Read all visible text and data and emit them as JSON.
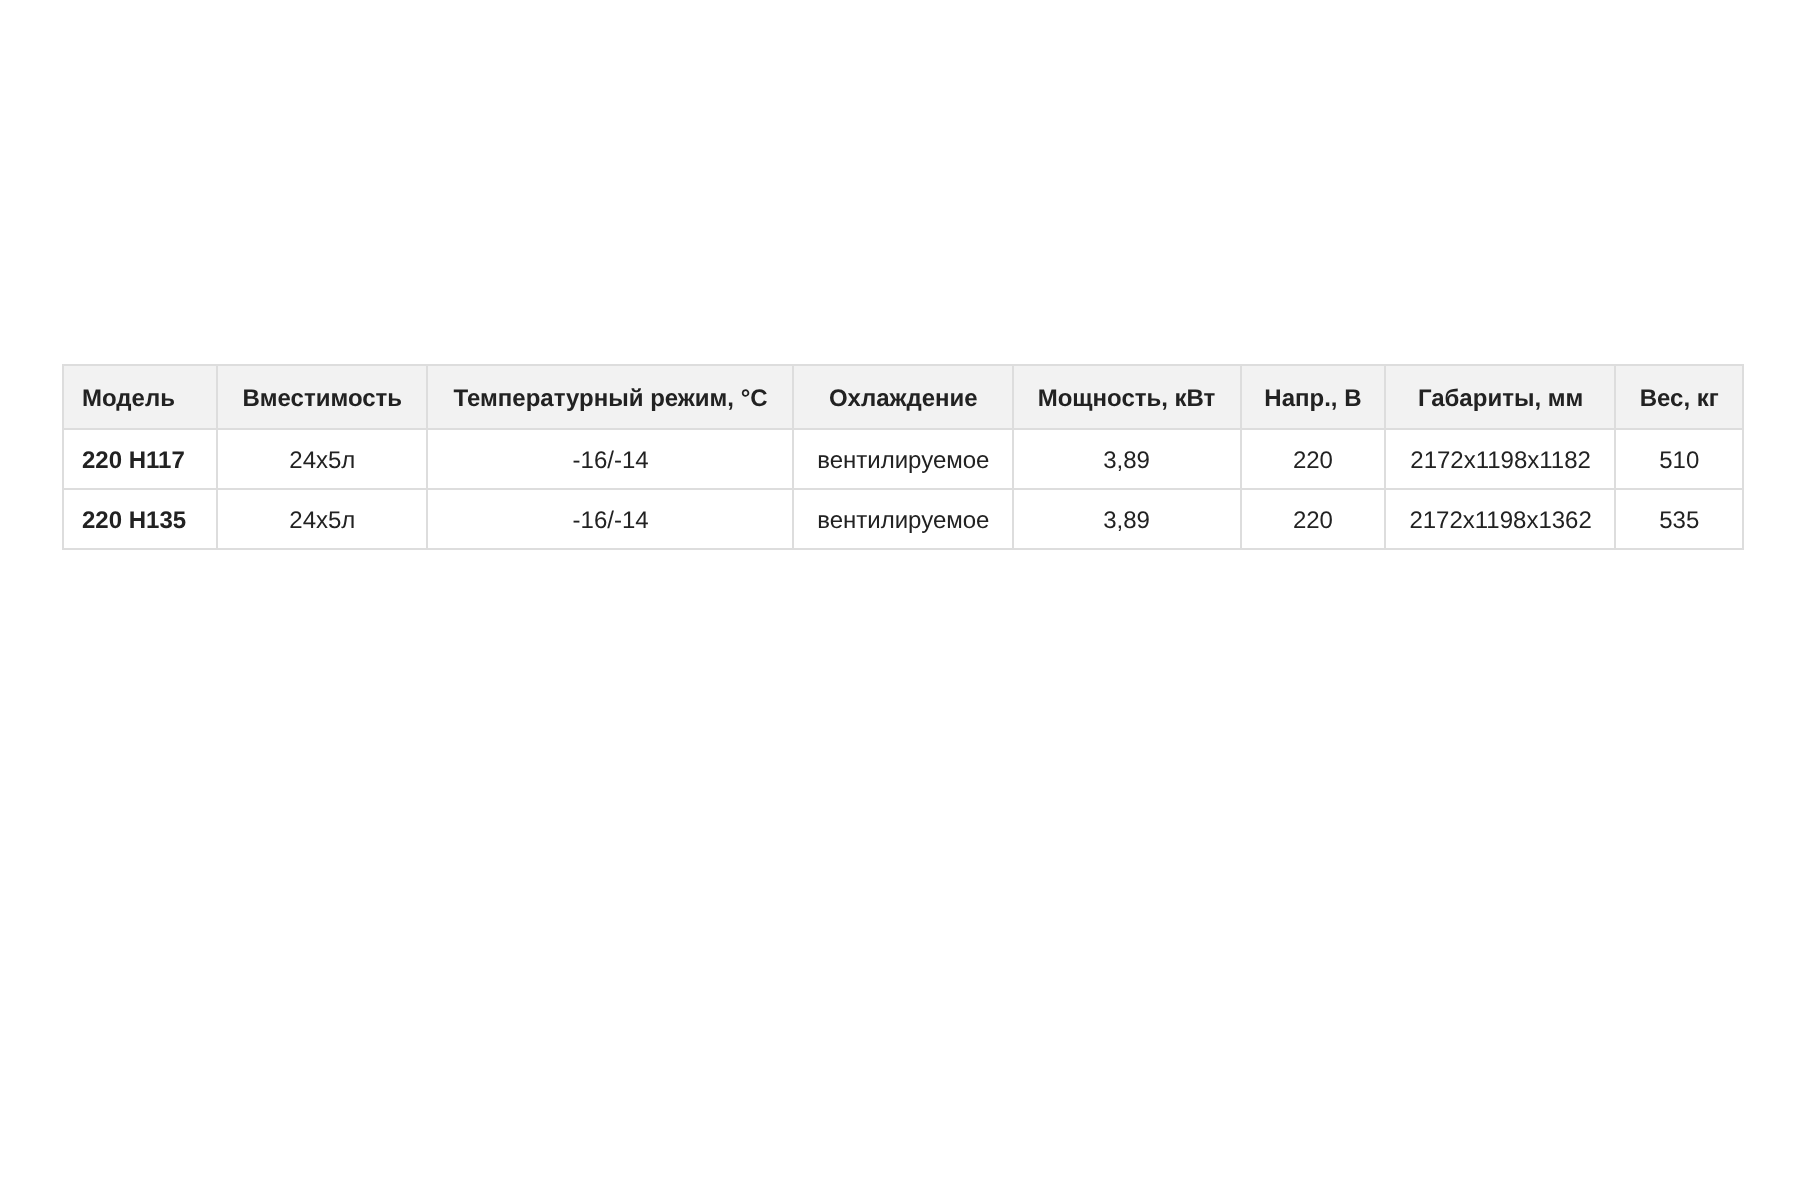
{
  "table": {
    "columns": [
      "Модель",
      "Вместимость",
      "Температурный режим, °C",
      "Охлаждение",
      "Мощность, кВт",
      "Напр., В",
      "Габариты, мм",
      "Вес, кг"
    ],
    "rows": [
      [
        "220 H117",
        "24x5л",
        "-16/-14",
        "вентилируемое",
        "3,89",
        "220",
        "2172x1198x1182",
        "510"
      ],
      [
        "220 H135",
        "24x5л",
        "-16/-14",
        "вентилируемое",
        "3,89",
        "220",
        "2172x1198x1362",
        "535"
      ]
    ]
  }
}
